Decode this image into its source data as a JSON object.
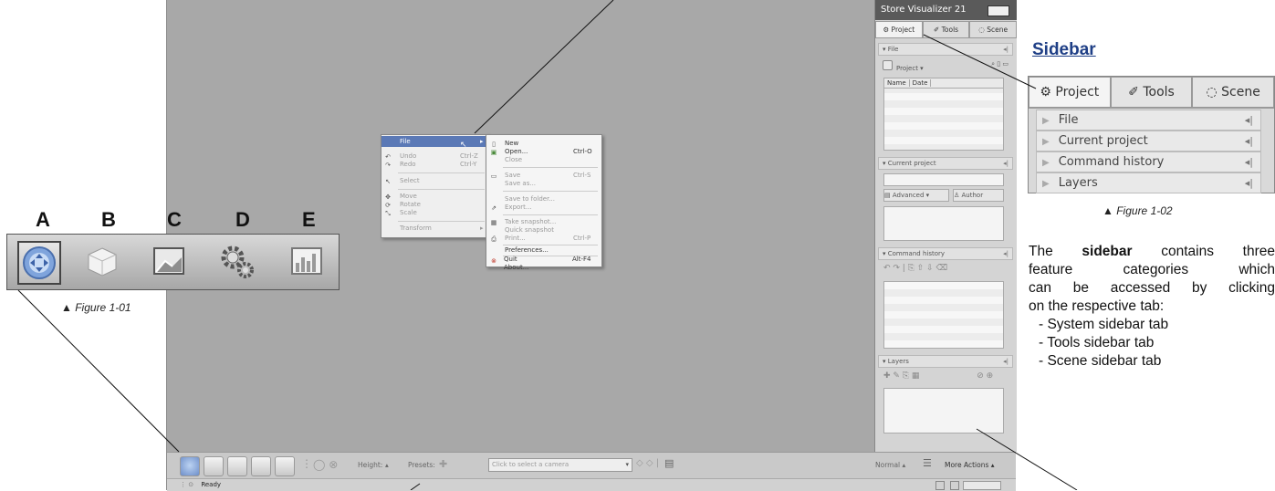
{
  "app": {
    "panel_title": "Store Visualizer 21",
    "tabs": [
      "Project",
      "Tools",
      "Scene"
    ],
    "sections": {
      "file": "File",
      "current_project": "Current project",
      "command_history": "Command history",
      "layers": "Layers"
    },
    "file_toolbar_label": "Project",
    "table_columns": [
      "Name",
      "Date"
    ],
    "advanced_label": "Advanced",
    "author_label": "Author",
    "status_text": "Ready",
    "toolbar": {
      "height_label": "Height:",
      "presets_label": "Presets:",
      "camera_placeholder": "Click to select a camera",
      "mode_value": "Normal",
      "more_actions": "More Actions"
    }
  },
  "menu": {
    "main": [
      {
        "label": "File",
        "shortcut": ""
      },
      {
        "label": "Undo",
        "shortcut": "Ctrl-Z"
      },
      {
        "label": "Redo",
        "shortcut": "Ctrl-Y"
      },
      {
        "label": "Select",
        "shortcut": ""
      },
      {
        "label": "Move",
        "shortcut": ""
      },
      {
        "label": "Rotate",
        "shortcut": ""
      },
      {
        "label": "Scale",
        "shortcut": ""
      },
      {
        "label": "Transform",
        "shortcut": ""
      }
    ],
    "file": [
      {
        "label": "New",
        "shortcut": ""
      },
      {
        "label": "Open...",
        "shortcut": "Ctrl-O"
      },
      {
        "label": "Close",
        "shortcut": ""
      },
      {
        "label": "Save",
        "shortcut": "Ctrl-S"
      },
      {
        "label": "Save as...",
        "shortcut": ""
      },
      {
        "label": "Save to folder...",
        "shortcut": ""
      },
      {
        "label": "Export...",
        "shortcut": ""
      },
      {
        "label": "Take snapshot...",
        "shortcut": ""
      },
      {
        "label": "Quick snapshot",
        "shortcut": ""
      },
      {
        "label": "Print...",
        "shortcut": "Ctrl-P"
      },
      {
        "label": "Preferences...",
        "shortcut": ""
      },
      {
        "label": "Quit",
        "shortcut": "Alt-F4"
      },
      {
        "label": "About...",
        "shortcut": ""
      }
    ]
  },
  "figure1": {
    "letters": [
      "A",
      "B",
      "C",
      "D",
      "E"
    ],
    "caption": "Figure 1-01"
  },
  "figure2": {
    "title": "Sidebar",
    "tabs": [
      "Project",
      "Tools",
      "Scene"
    ],
    "rows": [
      "File",
      "Current project",
      "Command history",
      "Layers"
    ],
    "caption": "Figure 1-02"
  },
  "description": {
    "line1_pre": "The ",
    "line1_bold": "sidebar",
    "line1_post": " contains three",
    "line2": "feature categories which",
    "line3": "can be accessed by clicking",
    "line4": "on the respective tab:",
    "items": [
      "- System sidebar tab",
      "- Tools sidebar tab",
      "- Scene sidebar tab"
    ]
  }
}
